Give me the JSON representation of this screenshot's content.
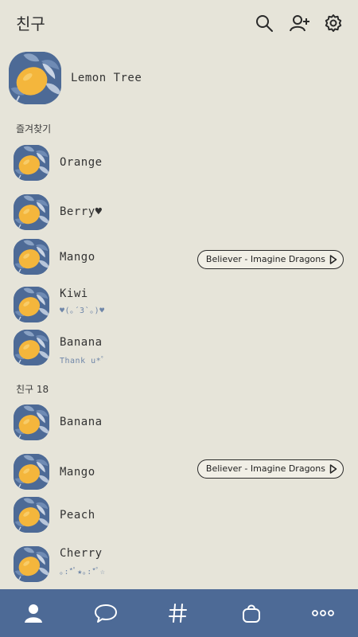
{
  "header": {
    "title": "친구"
  },
  "profile": {
    "name": "Lemon Tree"
  },
  "favorites": {
    "label": "즐겨찾기",
    "items": [
      {
        "name": "Orange",
        "status": ""
      },
      {
        "name": "Berry♥",
        "status": ""
      },
      {
        "name": "Mango",
        "status": "",
        "music": "Believer - Imagine Dragons"
      },
      {
        "name": "Kiwi",
        "status": "♥(｡´3`｡)♥"
      },
      {
        "name": "Banana",
        "status": "Thank u*ﾟ"
      }
    ]
  },
  "friends": {
    "label": "친구 18",
    "items": [
      {
        "name": "Banana",
        "status": ""
      },
      {
        "name": "Mango",
        "status": "",
        "music": "Believer - Imagine Dragons"
      },
      {
        "name": "Peach",
        "status": ""
      },
      {
        "name": "Cherry",
        "status": "｡:*ﾟ★｡:*ﾟ☆"
      }
    ]
  },
  "colors": {
    "accent": "#4d6a96",
    "background": "#e6e4d9",
    "lemon": "#f4b63c"
  },
  "tabbar": {
    "icons": [
      "person-icon",
      "chat-bubble-icon",
      "hashtag-icon",
      "shopping-bag-icon",
      "more-icon"
    ]
  }
}
